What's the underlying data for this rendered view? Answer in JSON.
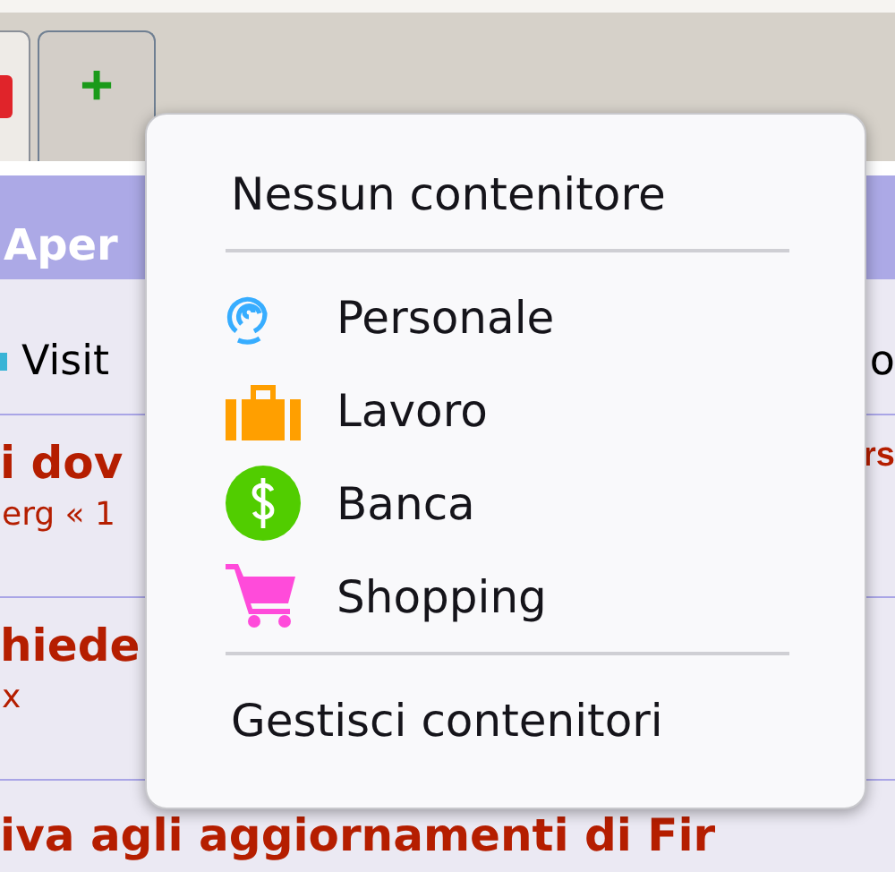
{
  "toolbar": {
    "new_tab_label": "+"
  },
  "page": {
    "header": "Aper",
    "rows": [
      {
        "kind": "plain",
        "left": "Visit",
        "right": "o"
      },
      {
        "kind": "topic",
        "left": "i dov",
        "right": "rs",
        "meta": "erg « 1"
      },
      {
        "kind": "topic",
        "left": "hiede",
        "right": "",
        "meta": "x"
      },
      {
        "kind": "wide",
        "left": "iva agli aggiornamenti di Fir"
      }
    ]
  },
  "menu": {
    "items": [
      {
        "kind": "plain",
        "label": "Nessun contenitore"
      },
      {
        "kind": "separator"
      },
      {
        "kind": "fingerprint",
        "label": "Personale",
        "color": "#37adff"
      },
      {
        "kind": "briefcase",
        "label": "Lavoro",
        "color": "#ff9f00"
      },
      {
        "kind": "dollar",
        "label": "Banca",
        "color": "#51cd00"
      },
      {
        "kind": "cart",
        "label": "Shopping",
        "color": "#ff4bda"
      },
      {
        "kind": "separator"
      },
      {
        "kind": "plain",
        "label": "Gestisci contenitori"
      }
    ]
  }
}
